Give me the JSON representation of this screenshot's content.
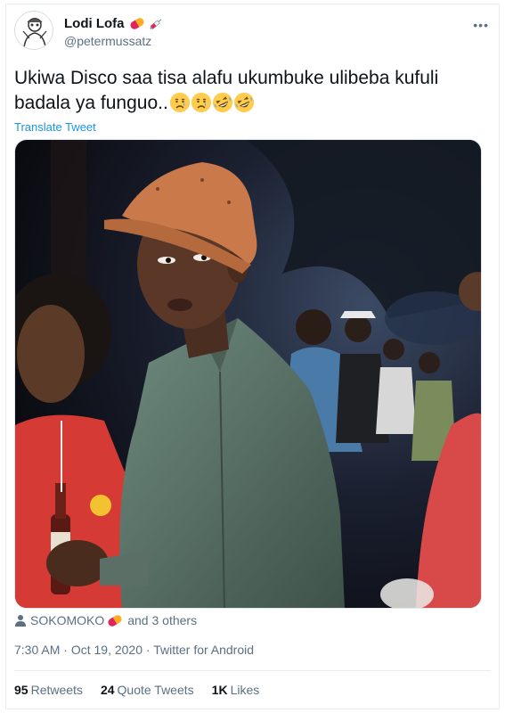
{
  "author": {
    "display_name": "Lodi Lofa",
    "handle": "@petermussatz"
  },
  "tweet": {
    "text": "Ukiwa Disco saa tisa alafu ukumbuke ulibeba kufuli badala ya funguo..",
    "trailing_emojis": [
      "crying-face",
      "crying-face",
      "rolling-laughing-face",
      "rolling-laughing-face"
    ],
    "translate_label": "Translate Tweet"
  },
  "liked_by": {
    "name": "SOKOMOKO",
    "others": "and 3 others"
  },
  "meta": {
    "time": "7:30 AM",
    "date": "Oct 19, 2020",
    "source": "Twitter for Android"
  },
  "stats": {
    "retweets_count": "95",
    "retweets_label": "Retweets",
    "quotes_count": "24",
    "quotes_label": "Quote Tweets",
    "likes_count": "1K",
    "likes_label": "Likes"
  },
  "colors": {
    "link": "#1b95e0",
    "secondary_text": "#5b7083",
    "emoji_yellow": "#ffcc4d"
  }
}
